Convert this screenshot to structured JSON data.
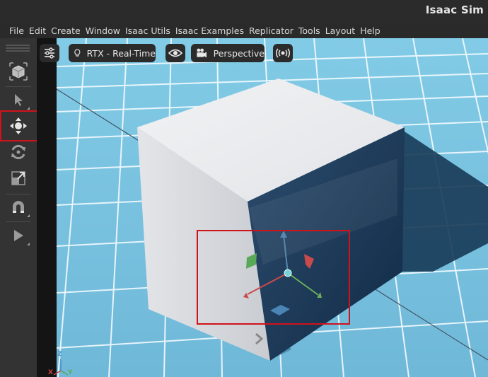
{
  "app": {
    "title": "Isaac Sim"
  },
  "menu": [
    "File",
    "Edit",
    "Create",
    "Window",
    "Isaac Utils",
    "Isaac Examples",
    "Replicator",
    "Tools",
    "Layout",
    "Help"
  ],
  "toolbar": {
    "tools": [
      {
        "name": "select-mode",
        "icon": "cube-select-icon"
      },
      {
        "name": "select",
        "icon": "cursor-arrow-icon"
      },
      {
        "name": "move",
        "icon": "move-arrows-icon",
        "active": true
      },
      {
        "name": "rotate",
        "icon": "rotate-icon"
      },
      {
        "name": "scale",
        "icon": "scale-icon"
      },
      {
        "name": "snap",
        "icon": "magnet-icon"
      },
      {
        "name": "play",
        "icon": "play-icon"
      }
    ]
  },
  "viewport": {
    "settings_icon": "sliders-icon",
    "renderer_icon": "lightbulb-icon",
    "renderer_label": "RTX - Real-Time",
    "visibility_icon": "eye-icon",
    "camera_icon": "camera-icon",
    "camera_label": "Perspective",
    "audio_icon": "broadcast-icon",
    "axis": {
      "x": "X",
      "y": "Y",
      "z": "Z"
    }
  },
  "colors": {
    "accent_highlight": "#d0121b",
    "floor": "#7ec8e3",
    "grid": "#f4fbff",
    "axis_x": "#d04040",
    "axis_y": "#5aaa55",
    "axis_z": "#4a90c8"
  }
}
